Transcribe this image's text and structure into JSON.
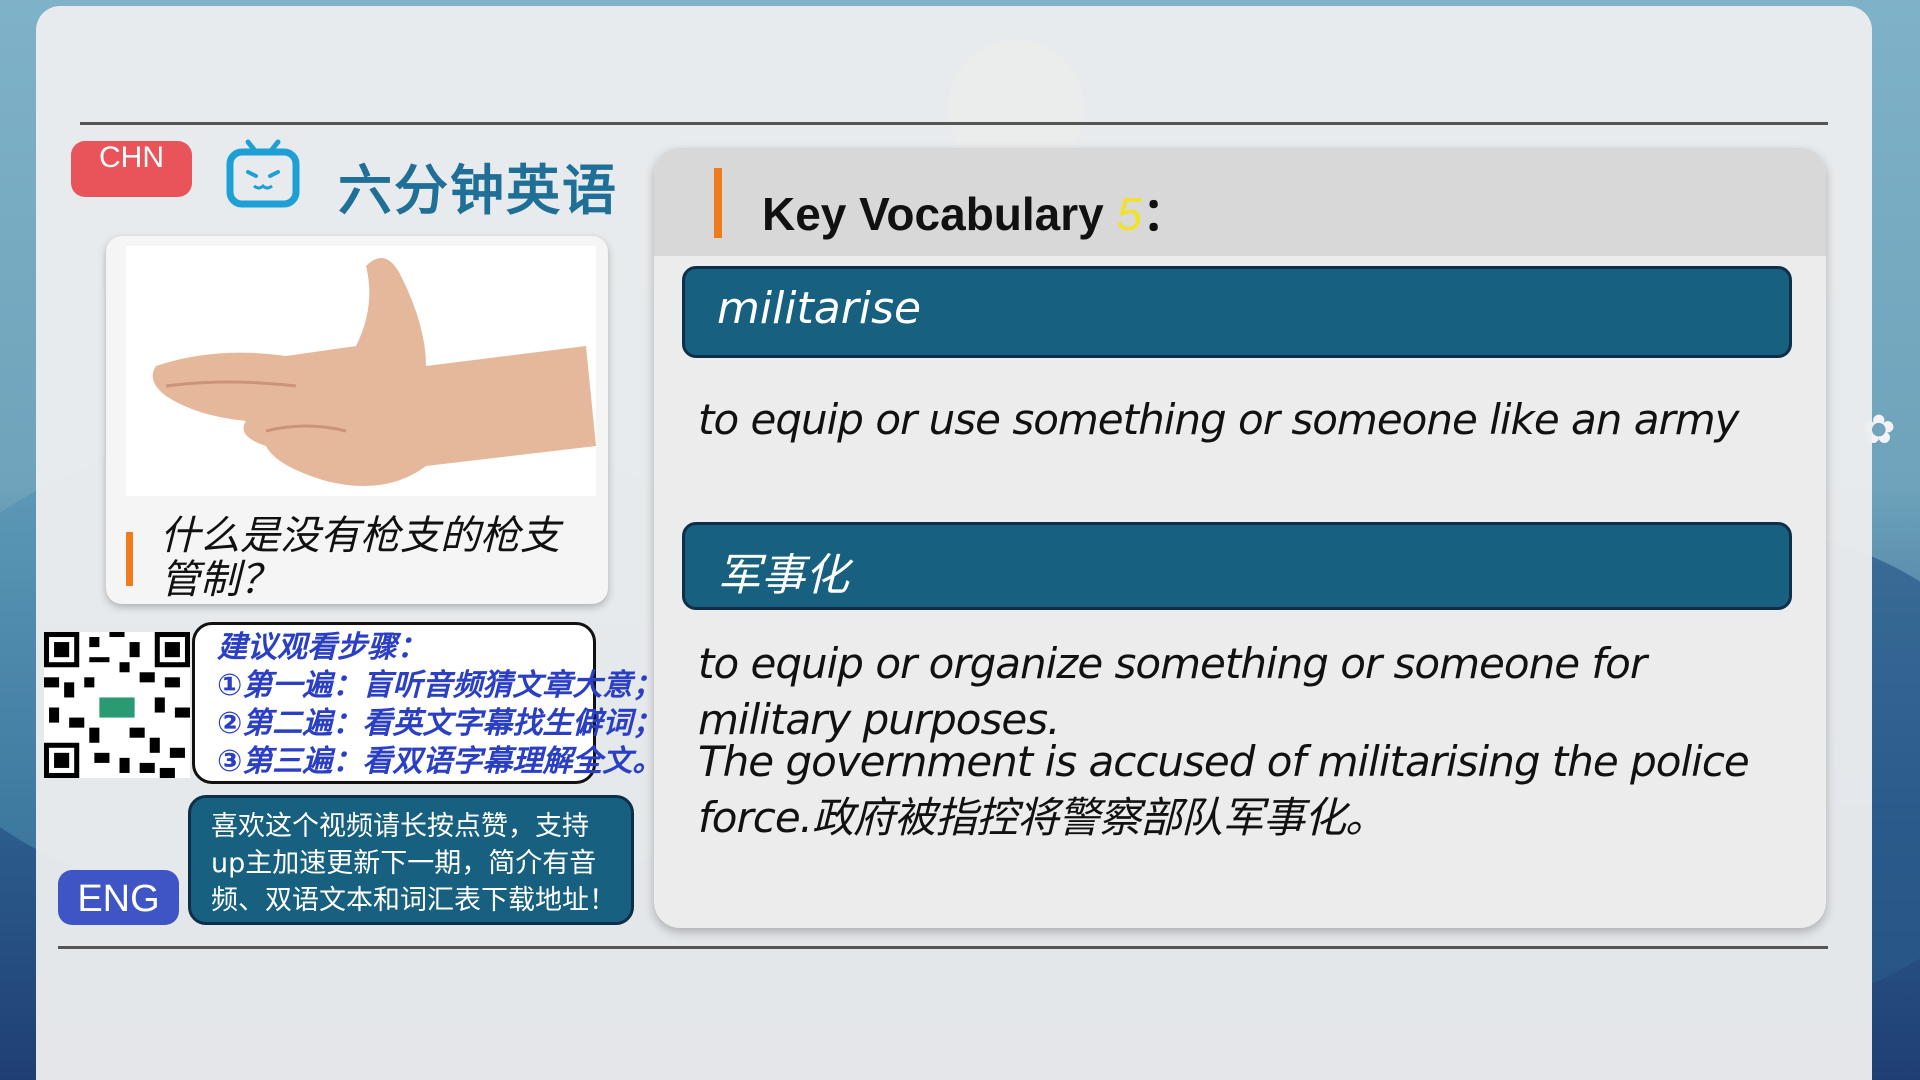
{
  "header": {
    "chn_label": "CHN",
    "brand_title": "六分钟英语"
  },
  "topic": {
    "question": "什么是没有枪支的枪支管制？"
  },
  "steps": {
    "lines": [
      "建议观看步骤：",
      "①第一遍：盲听音频猜文章大意；",
      "②第二遍：看英文字幕找生僻词；",
      "③第三遍：看双语字幕理解全文。"
    ]
  },
  "promo": {
    "lines": [
      "喜欢这个视频请长按点赞，支持",
      "up主加速更新下一期，简介有音",
      "频、双语文本和词汇表下载地址！"
    ]
  },
  "eng_label": "ENG",
  "vocab": {
    "title": "Key Vocabulary",
    "number": "5",
    "colon": "：",
    "word_en": "militarise",
    "def_en": "to equip or use something or someone like an army",
    "word_cn": "军事化",
    "def_cn": "to equip or organize something or someone for military purposes.",
    "example": "The government is accused of militarising the police force.政府被指控将警察部队军事化。"
  },
  "colors": {
    "accent_orange": "#f07b1a",
    "word_bar": "#17607f",
    "chn_button": "#e9535a",
    "eng_button": "#3f55c6",
    "brand_blue": "#1f6f96"
  }
}
